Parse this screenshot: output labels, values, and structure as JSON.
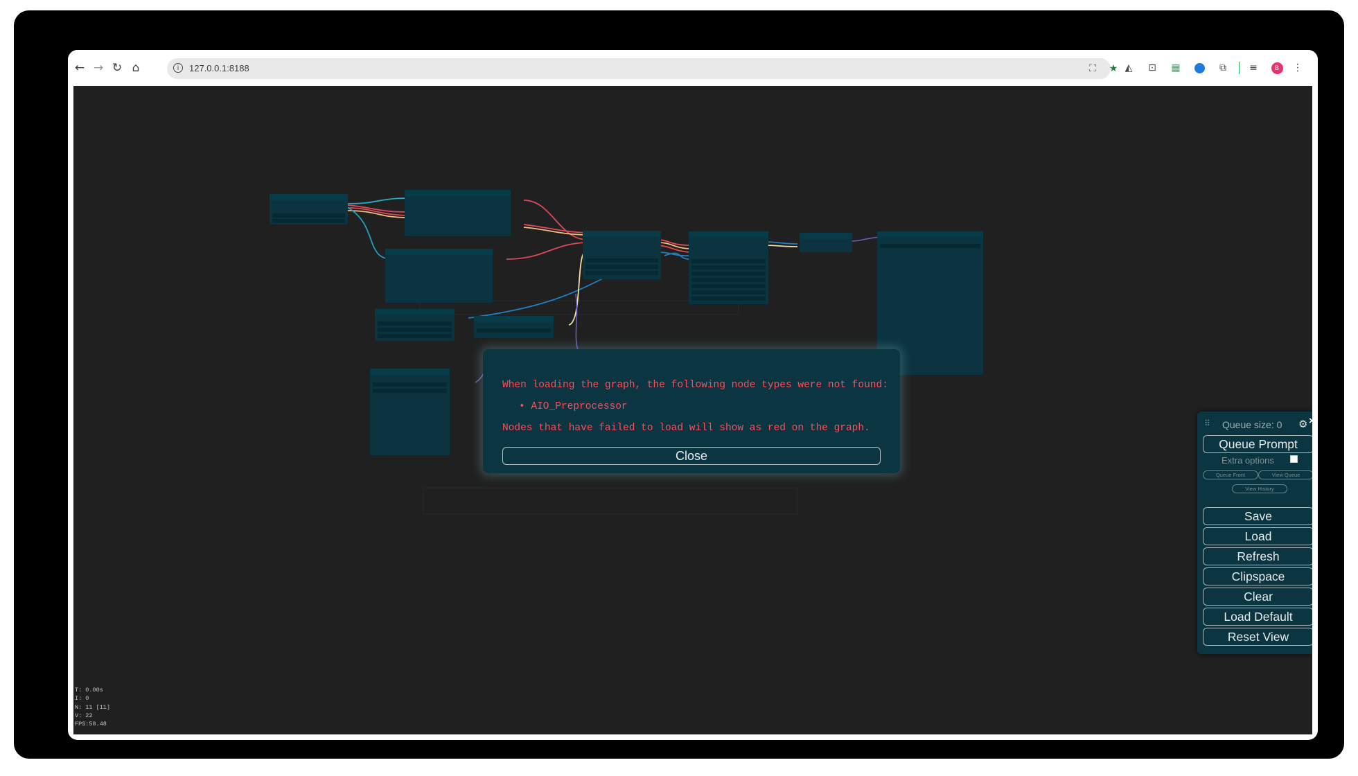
{
  "browser": {
    "url": "127.0.0.1:8188",
    "avatar_letter": "B",
    "accent_star": "#1e7d32",
    "avatar_color": "#e8336b"
  },
  "stats": {
    "t": "T: 0.00s",
    "i": "I: 0",
    "n": "N: 11 [11]",
    "v": "V: 22",
    "fps": "FPS:58.48"
  },
  "dialog": {
    "message": "When loading the graph, the following node types were not found:",
    "missing_nodes": [
      "AIO_Preprocessor"
    ],
    "footer": "Nodes that have failed to load will show as red on the graph.",
    "close_label": "Close",
    "text_color": "#ff4d5a"
  },
  "panel": {
    "queue_size": "Queue size: 0",
    "queue_prompt": "Queue Prompt",
    "extra_options": "Extra options",
    "queue_front": "Queue Front",
    "view_queue": "View Queue",
    "view_history": "View History",
    "save": "Save",
    "load": "Load",
    "refresh": "Refresh",
    "clipspace": "Clipspace",
    "clear": "Clear",
    "load_default": "Load Default",
    "reset_view": "Reset View"
  }
}
